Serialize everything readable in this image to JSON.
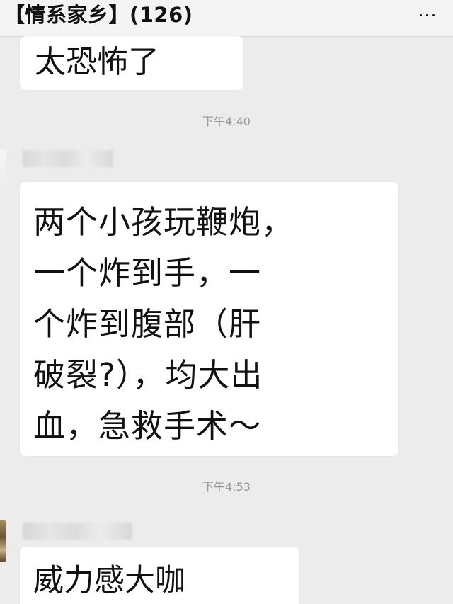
{
  "header": {
    "title": "【情系家乡】(126)",
    "menu_icon": "more-icon"
  },
  "messages": [
    {
      "text": "太恐怖了"
    },
    {
      "timestamp": "下午4:40",
      "text": "两个小孩玩鞭炮，\n一个炸到手，一\n个炸到腹部（肝\n破裂?），均大出\n血，急救手术～"
    },
    {
      "timestamp": "下午4:53",
      "text": "威力感大咖"
    }
  ],
  "colors": {
    "background": "#ececec",
    "header": "#f4f4f4",
    "bubble": "#ffffff",
    "timestamp": "#9a9a9a"
  }
}
